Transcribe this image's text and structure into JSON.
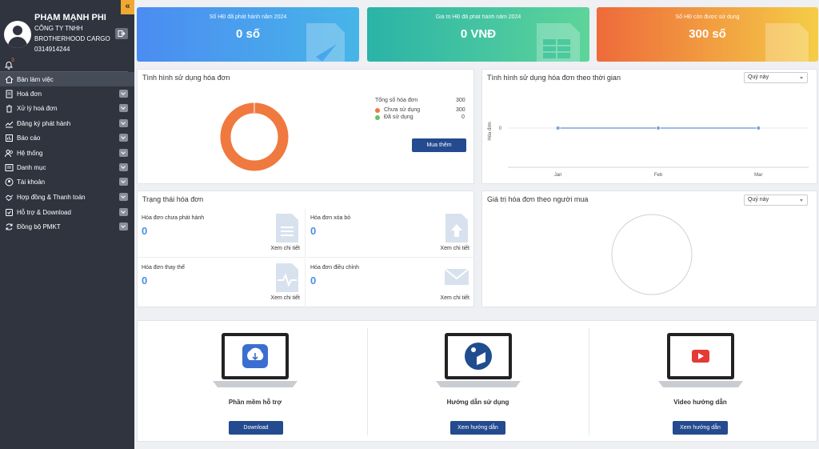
{
  "sidebar": {
    "collapse_icon": "«",
    "user": {
      "name": "PHẠM MẠNH PHI",
      "company_line1": "CÔNG TY TNHH",
      "company_line2": "BROTHERHOOD CARGO",
      "phone": "0314914244"
    },
    "notification_count": "3",
    "items": [
      {
        "label": "Bàn làm việc",
        "icon": "home-icon"
      },
      {
        "label": "Hoá đơn",
        "icon": "invoice-icon"
      },
      {
        "label": "Xử lý hoá đơn",
        "icon": "trash-icon"
      },
      {
        "label": "Đăng ký phát hành",
        "icon": "register-icon"
      },
      {
        "label": "Báo cáo",
        "icon": "report-icon"
      },
      {
        "label": "Hệ thống",
        "icon": "users-icon"
      },
      {
        "label": "Danh mục",
        "icon": "list-icon"
      },
      {
        "label": "Tài khoản",
        "icon": "account-icon"
      },
      {
        "label": "Hợp đồng & Thanh toán",
        "icon": "contract-icon"
      },
      {
        "label": "Hỗ trợ & Download",
        "icon": "support-icon"
      },
      {
        "label": "Đồng bộ PMKT",
        "icon": "sync-icon"
      }
    ]
  },
  "cards": [
    {
      "label": "Số HĐ đã phát hành năm 2024",
      "value": "0 số"
    },
    {
      "label": "Giá trị HĐ đã phát hành năm 2024",
      "value": "0 VNĐ"
    },
    {
      "label": "Số HĐ còn được sử dụng",
      "value": "300 số"
    }
  ],
  "usage": {
    "title": "Tình hình sử dụng hóa đơn",
    "total_label": "Tổng số hóa đơn",
    "total_value": "300",
    "unused_label": "Chưa sử dụng",
    "unused_value": "300",
    "used_label": "Đã sử dụng",
    "used_value": "0",
    "buy_button": "Mua thêm",
    "colors": {
      "unused": "#f0793f",
      "used": "#6abf69"
    }
  },
  "timeline": {
    "title": "Tình hình sử dụng hóa đơn theo thời gian",
    "period": "Quý này"
  },
  "chart_data": {
    "type": "line",
    "categories": [
      "Jan",
      "Feb",
      "Mar"
    ],
    "series": [
      {
        "values": [
          0,
          0,
          0
        ]
      }
    ],
    "ylabel": "Hóa đơn",
    "yticks": [
      "0"
    ]
  },
  "status": {
    "title": "Trạng thái hóa đơn",
    "items": [
      {
        "label": "Hóa đơn chưa phát hành",
        "value": "0",
        "link": "Xem chi tiết"
      },
      {
        "label": "Hóa đơn xóa bỏ",
        "value": "0",
        "link": "Xem chi tiết"
      },
      {
        "label": "Hóa đơn thay thế",
        "value": "0",
        "link": "Xem chi tiết"
      },
      {
        "label": "Hóa đơn điều chỉnh",
        "value": "0",
        "link": "Xem chi tiết"
      }
    ]
  },
  "buyer": {
    "title": "Giá trị hóa đơn theo người mua",
    "period": "Quý này"
  },
  "resources": [
    {
      "title": "Phần mềm hỗ trợ",
      "button": "Download"
    },
    {
      "title": "Hướng dẫn sử dụng",
      "button": "Xem hướng dẫn"
    },
    {
      "title": "Video hướng dẫn",
      "button": "Xem hướng dẫn"
    }
  ]
}
